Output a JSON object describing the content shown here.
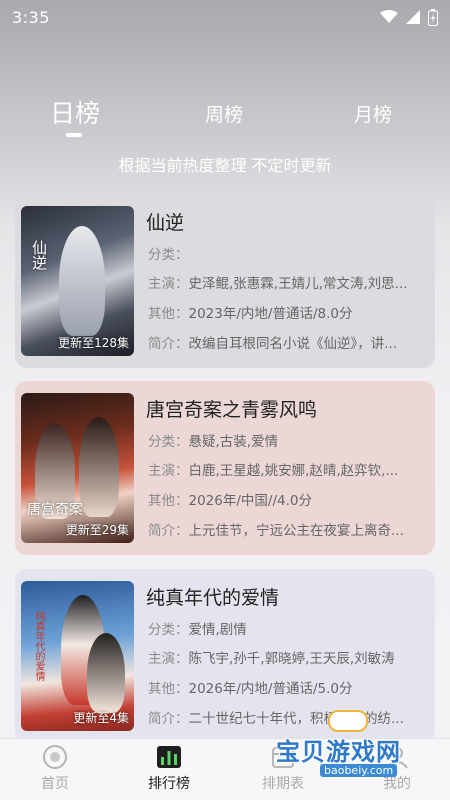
{
  "status": {
    "time": "3:35"
  },
  "tabs": {
    "day": "日榜",
    "week": "周榜",
    "month": "月榜",
    "active": "日榜"
  },
  "subtitle": "根据当前热度整理 不定时更新",
  "labels": {
    "genre": "分类：",
    "cast": "主演：",
    "other": "其他：",
    "intro": "简介："
  },
  "items": [
    {
      "title": "仙逆",
      "genre": "",
      "cast": "史泽鲲,张惠霖,王婧儿,常文涛,刘思...",
      "other": "2023年/内地/普通话/8.0分",
      "intro": "改编自耳根同名小说《仙逆》，讲...",
      "badge": "更新至128集",
      "poster_title": "仙逆"
    },
    {
      "title": "唐宫奇案之青雾风鸣",
      "genre": "悬疑,古装,爱情",
      "cast": "白鹿,王星越,姚安娜,赵晴,赵弈钦,...",
      "other": "2026年/中国//4.0分",
      "intro": "上元佳节，宁远公主在夜宴上离奇...",
      "badge": "更新至29集",
      "poster_title": "唐宫奇案"
    },
    {
      "title": "纯真年代的爱情",
      "genre": "爱情,剧情",
      "cast": "陈飞宇,孙千,郭晓婷,王天辰,刘敏涛",
      "other": "2026年/内地/普通话/5.0分",
      "intro": "二十世纪七十年代，积极上进的纺...",
      "badge": "更新至4集",
      "poster_title": "纯真年代的爱情"
    }
  ],
  "nav": {
    "home": "首页",
    "rank": "排行榜",
    "schedule": "排期表",
    "mine": "我的"
  },
  "watermark": {
    "text": "宝贝游戏网",
    "url": "baobeiy.com"
  },
  "colors": {
    "accent": "#2f79c9",
    "nav_active": "#222222",
    "nav_inactive": "#aaaaaa"
  }
}
